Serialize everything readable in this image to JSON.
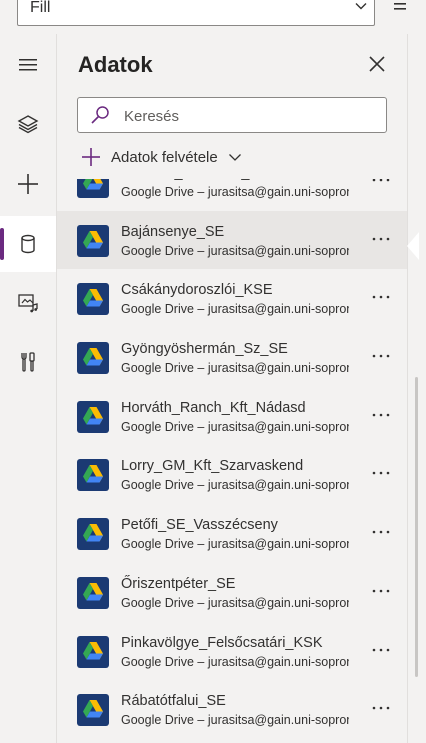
{
  "property_bar": {
    "selected_property": "Fill"
  },
  "panel": {
    "title": "Adatok",
    "search_placeholder": "Keresés",
    "add_data_label": "Adatok felvétele"
  },
  "rail": {
    "items": [
      "hamburger-menu",
      "layers",
      "insert",
      "data",
      "media",
      "advanced-tools"
    ],
    "active": "data"
  },
  "data_sources": [
    {
      "name": "Tutitextil_Körmend_VSE",
      "subtitle": "Google Drive – jurasitsa@gain.uni-sopron.hu"
    },
    {
      "name": "Bajánsenye_SE",
      "subtitle": "Google Drive – jurasitsa@gain.uni-sopron.hu",
      "selected": true
    },
    {
      "name": "Csákánydoroszlói_KSE",
      "subtitle": "Google Drive – jurasitsa@gain.uni-sopron.hu"
    },
    {
      "name": "Gyöngyöshermán_Sz_SE",
      "subtitle": "Google Drive – jurasitsa@gain.uni-sopron.hu"
    },
    {
      "name": "Horváth_Ranch_Kft_Nádasd",
      "subtitle": "Google Drive – jurasitsa@gain.uni-sopron.hu"
    },
    {
      "name": "Lorry_GM_Kft_Szarvaskend",
      "subtitle": "Google Drive – jurasitsa@gain.uni-sopron.hu"
    },
    {
      "name": "Petőfi_SE_Vasszécseny",
      "subtitle": "Google Drive – jurasitsa@gain.uni-sopron.hu"
    },
    {
      "name": "Őriszentpéter_SE",
      "subtitle": "Google Drive – jurasitsa@gain.uni-sopron.hu"
    },
    {
      "name": "Pinkavölgye_Felsőcsatári_KSK",
      "subtitle": "Google Drive – jurasitsa@gain.uni-sopron.hu"
    },
    {
      "name": "Rábatótfalui_SE",
      "subtitle": "Google Drive – jurasitsa@gain.uni-sopron.hu"
    }
  ],
  "colors": {
    "accent": "#6b2a80",
    "drive_tile": "#1b3a73",
    "selected_row": "#e8e6e4"
  },
  "icons": {
    "item_icon": "google-drive-icon",
    "item_menu": "more-options-icon"
  }
}
